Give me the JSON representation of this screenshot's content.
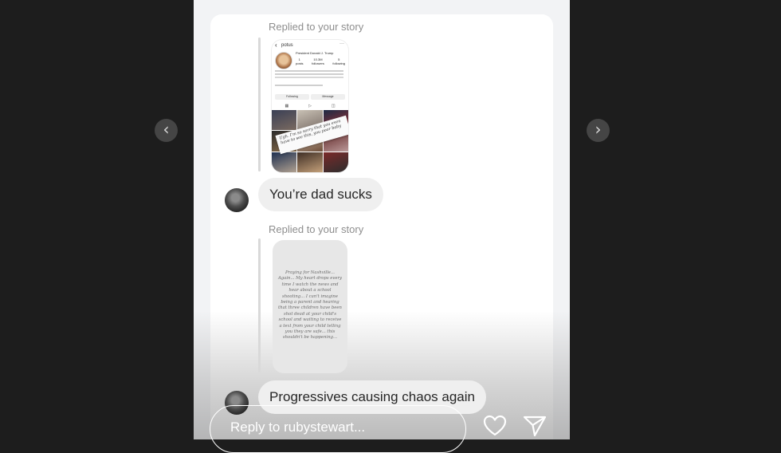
{
  "thread": {
    "messages": [
      {
        "type": "story_reply",
        "label": "Replied to your story"
      },
      {
        "type": "text",
        "text": "You’re dad sucks"
      },
      {
        "type": "story_reply",
        "label": "Replied to your story"
      },
      {
        "type": "text",
        "text": "Progressives causing chaos again"
      }
    ]
  },
  "story1": {
    "handle": "potus",
    "name": "President Donald J. Trump",
    "stats": [
      {
        "value": "1",
        "label": "posts"
      },
      {
        "value": "10.3M",
        "label": "followers"
      },
      {
        "value": "5",
        "label": "following"
      }
    ],
    "buttons": [
      "Following",
      "Message"
    ],
    "note": "Ugh. I'm so sorry that you even have to see this, you poor baby"
  },
  "story2": {
    "text": "Praying for Nashville... Again... My heart drops every time I watch the news and hear about a school shooting... I can't imagine being a parent and hearing that three children have been shot dead at your child's school and waiting to receive a text from your child telling you they are safe... this shouldn't be happening..."
  },
  "composer": {
    "placeholder": "Reply to rubystewart..."
  },
  "icons": {
    "prev": "chevron-left-icon",
    "next": "chevron-right-icon",
    "like": "heart-icon",
    "send": "send-icon"
  },
  "colors": {
    "background": "#1d1d1d",
    "bubble": "#efefef",
    "meta_text": "#8e8e8e"
  }
}
